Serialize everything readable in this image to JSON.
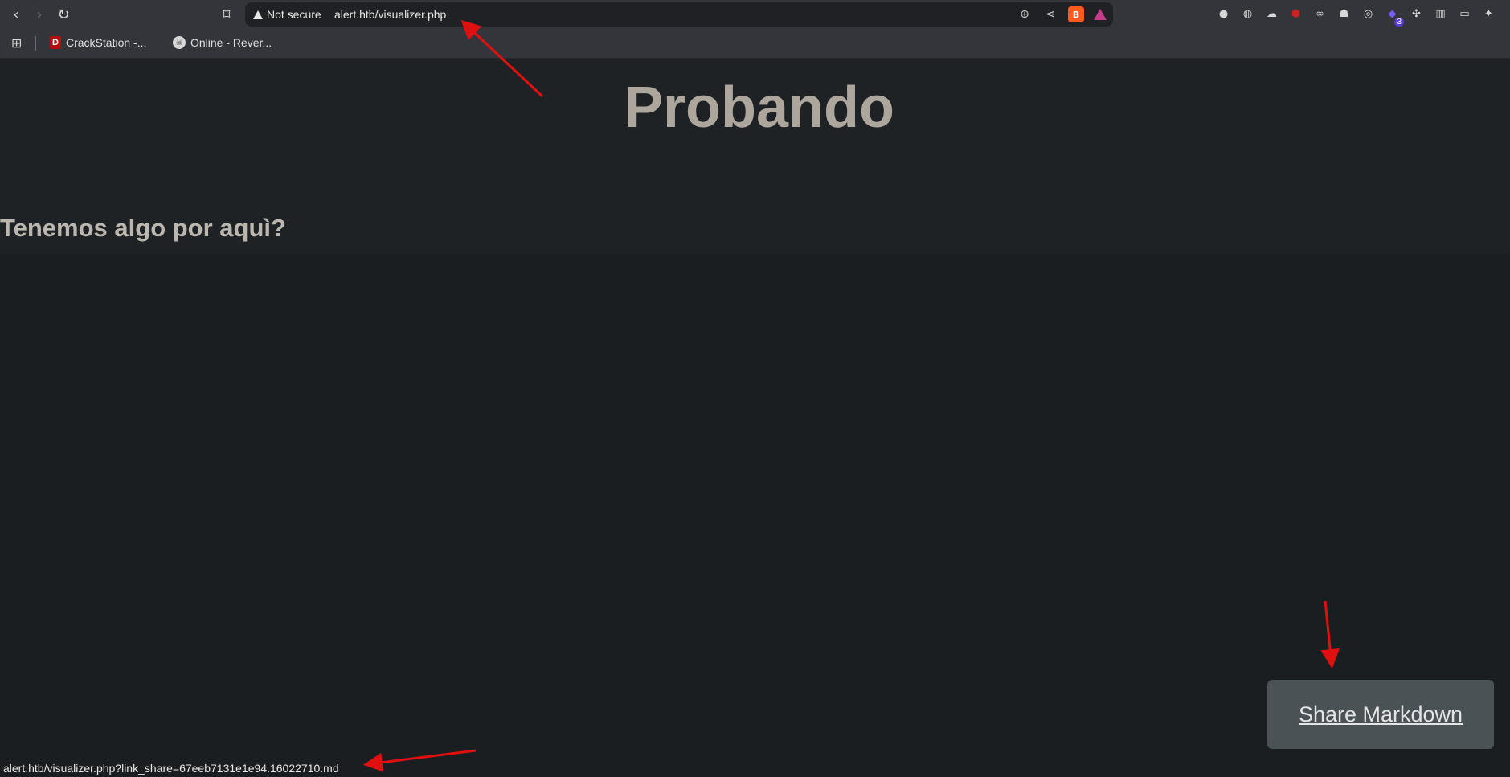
{
  "browser": {
    "security_label": "Not secure",
    "url": "alert.htb/visualizer.php",
    "extension_badge": "3",
    "bookmarks": [
      {
        "label": "CrackStation -..."
      },
      {
        "label": "Online - Rever..."
      }
    ]
  },
  "page": {
    "title": "Probando",
    "subheading": "Tenemos algo por aquì?",
    "share_button_label": "Share Markdown"
  },
  "status_bar": {
    "hover_url": "alert.htb/visualizer.php?link_share=67eeb7131e1e94.16022710.md"
  },
  "colors": {
    "annotation_arrow": "#e01010",
    "page_background": "#1b1e20",
    "title_text": "#aca69d"
  }
}
